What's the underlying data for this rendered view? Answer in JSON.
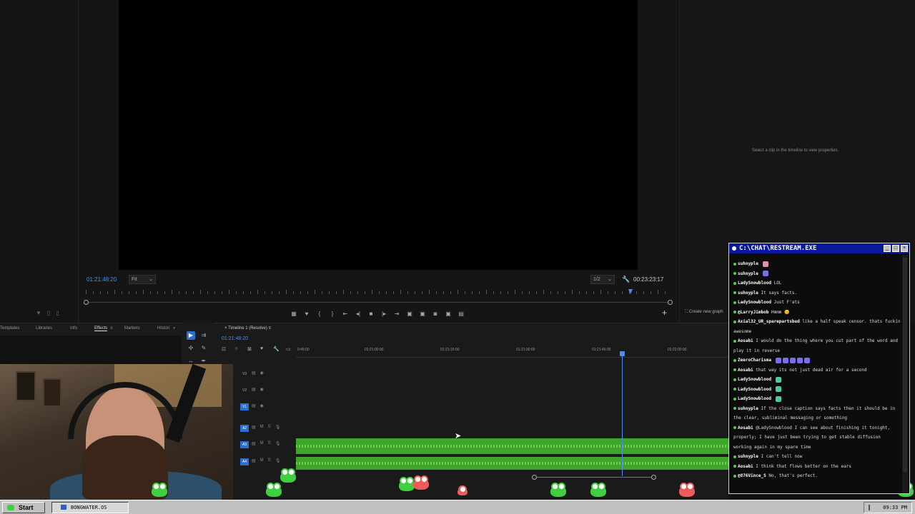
{
  "program_monitor": {
    "timecode_left": "01:21:48:20",
    "fit_label": "Fit",
    "ratio_label": "1/2",
    "timecode_right": "00:23:23:17"
  },
  "properties": {
    "empty_text": "Select a clip in the timeline to view properties.",
    "create_graphic": "Create new graph"
  },
  "tabs": {
    "templates": "Templates",
    "libraries": "Libraries",
    "info": "Info",
    "effects": "Effects",
    "markers": "Markers",
    "history": "Histori"
  },
  "timeline": {
    "tab_label": "Timeline 1 (Resolve)",
    "timecode": "01:21:48:20",
    "ruler_labels": [
      "0:45:00",
      "01:21:00:00",
      "01:21:15:00",
      "01:21:30:00",
      "01:21:45:00",
      "01:22:00:00"
    ],
    "tracks": {
      "v3": "V3",
      "v2": "V2",
      "v1": "V1",
      "a2": "A2",
      "a3": "A3",
      "a4": "A4"
    }
  },
  "chat": {
    "title": "C:\\CHAT\\RESTREAM.EXE",
    "messages": [
      {
        "user": "suhnyple",
        "text": "",
        "emote": "pink"
      },
      {
        "user": "suhnyple",
        "text": "",
        "emote": "purple"
      },
      {
        "user": "LadySnowblood",
        "text": "LOL"
      },
      {
        "user": "suhnyple",
        "text": "It says facts."
      },
      {
        "user": "LadySnowblood",
        "text": "Just F'ats"
      },
      {
        "user": "@LarryJimbob",
        "text": "Hmmm 😊"
      },
      {
        "user": "Axial32_UR_sparepartsbud",
        "text": "like a half speak censor. thats fuckin awesome"
      },
      {
        "user": "Aosabi",
        "text": "I would do the thing where you cut part of the word and play it in reverse"
      },
      {
        "user": "ZeeroCharisma",
        "text": "",
        "emote": "purple"
      },
      {
        "user": "Aosabi",
        "text": "that way its not just dead air for a second"
      },
      {
        "user": "LadySnowblood",
        "text": "",
        "emote": "teal"
      },
      {
        "user": "LadySnowblood",
        "text": "",
        "emote": "teal"
      },
      {
        "user": "LadySnowblood",
        "text": "",
        "emote": "teal"
      },
      {
        "user": "suhnyple",
        "text": "If the close caption says facts then it should be in the clear, subliminal messaging or something"
      },
      {
        "user": "Aosabi",
        "text": "@LadySnowblood I can see about finishing it tonight, properly; I have just been trying to get stable diffusion working again in my spare time"
      },
      {
        "user": "suhnyple",
        "text": "I can't tell now"
      },
      {
        "user": "Aosabi",
        "text": "I think that flows better on the ears"
      },
      {
        "user": "@876Vince_S",
        "text": "No, that's perfect."
      }
    ]
  },
  "taskbar": {
    "start": "Start",
    "task": "BONGWATER.OS",
    "clock": "09:33 PM"
  },
  "colors": {
    "accent": "#2d6fd0",
    "audio_clip": "#3ea52a",
    "chat_title": "#0a1a9a",
    "taskbar": "#c0c0c0"
  }
}
